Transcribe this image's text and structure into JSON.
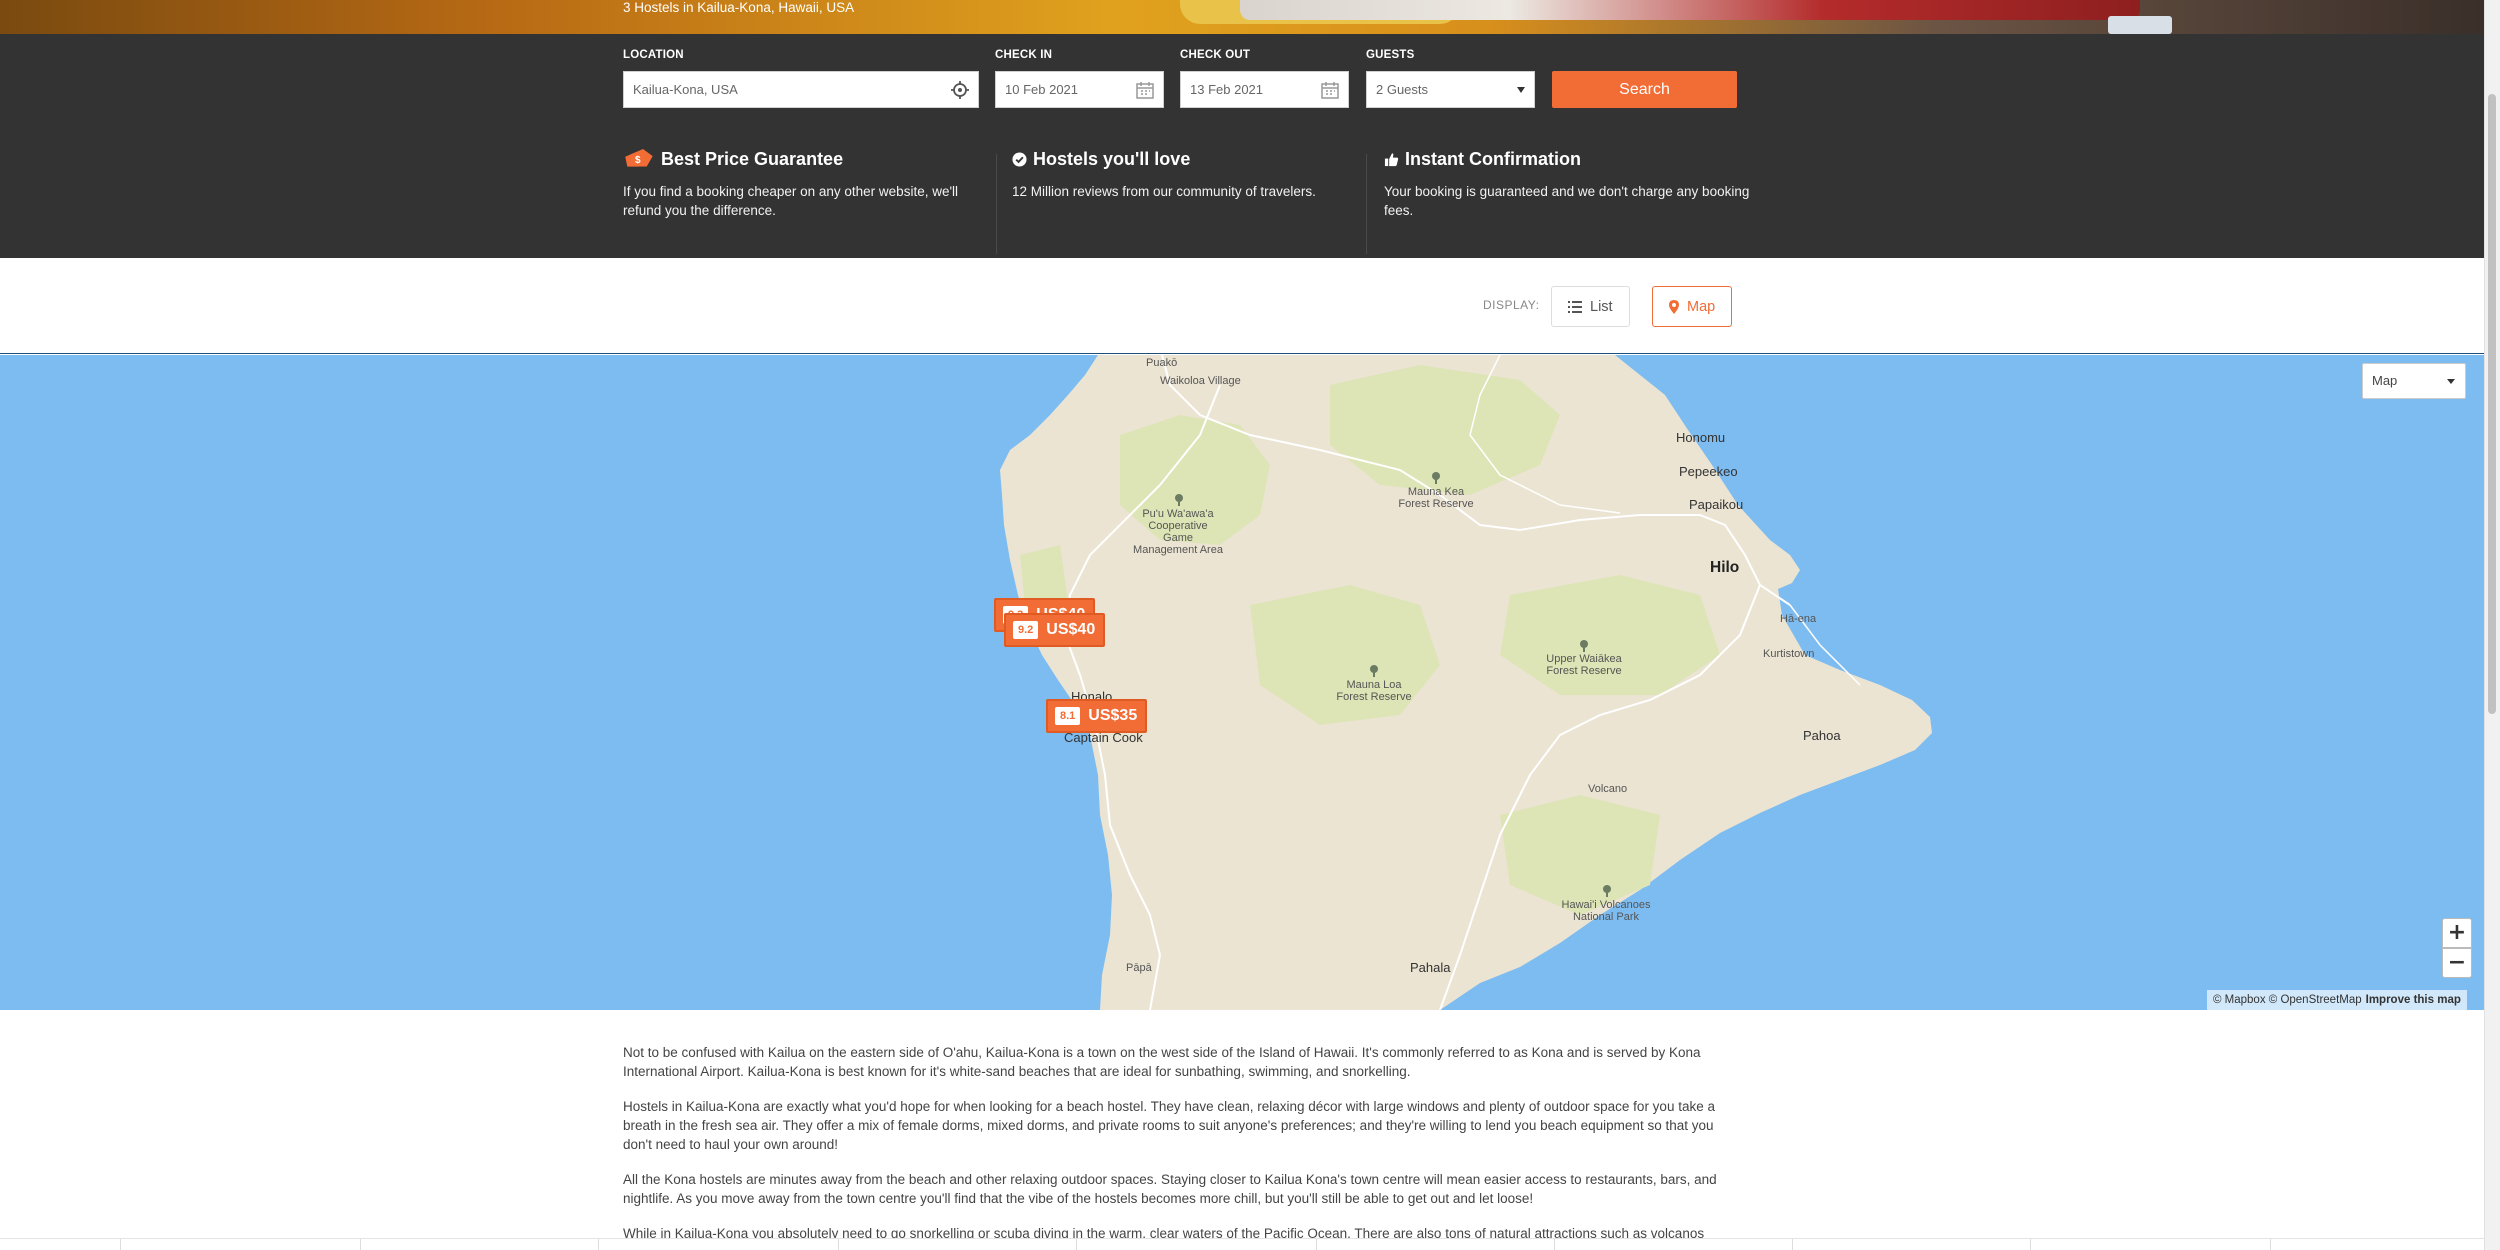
{
  "hero": {
    "title": "3 Hostels in Kailua-Kona, Hawaii, USA"
  },
  "search": {
    "location_label": "LOCATION",
    "location_value": "Kailua-Kona, USA",
    "checkin_label": "CHECK IN",
    "checkin_value": "10 Feb 2021",
    "checkout_label": "CHECK OUT",
    "checkout_value": "13 Feb 2021",
    "guests_label": "GUESTS",
    "guests_value": "2 Guests",
    "search_button": "Search"
  },
  "features": [
    {
      "title": "Best Price Guarantee",
      "text": "If you find a booking cheaper on any other website, we'll refund you the difference.",
      "icon": "price-tag-icon"
    },
    {
      "title": "Hostels you'll love",
      "text": "12 Million reviews from our community of travelers.",
      "icon": "check-circle-icon"
    },
    {
      "title": "Instant Confirmation",
      "text": "Your booking is guaranteed and we don't charge any booking fees.",
      "icon": "thumbs-up-icon"
    }
  ],
  "display": {
    "label": "DISPLAY:",
    "list_label": "List",
    "map_label": "Map",
    "active": "Map"
  },
  "map": {
    "style_select": "Map",
    "zoom_in": "+",
    "zoom_out": "−",
    "attribution": "© Mapbox © OpenStreetMap",
    "improve": "Improve this map",
    "labels": {
      "puako": "Puakō",
      "waikoloa": "Waikoloa Village",
      "puuwaawaa": "Pu'u Wa'awa'a Cooperative Game Management Area",
      "maunakea": "Mauna Kea Forest Reserve",
      "honomu": "Honomu",
      "pepeekeo": "Pepeekeo",
      "papaikou": "Papaikou",
      "hilo": "Hilo",
      "haena": "Hā-ena",
      "kurtistown": "Kurtistown",
      "upperwaiakea": "Upper Waiākea Forest Reserve",
      "maunaloa": "Mauna Loa Forest Reserve",
      "honalo": "Honalo",
      "captaincook": "Captain Cook",
      "pahoa": "Pahoa",
      "volcano": "Volcano",
      "hawaiivolcanoes": "Hawai'i Volcanoes National Park",
      "papa": "Pāpā",
      "pahala": "Pahala"
    },
    "markers": [
      {
        "score": "9.3",
        "price": "US$40"
      },
      {
        "score": "9.2",
        "price": "US$40"
      },
      {
        "score": "8.1",
        "price": "US$35"
      }
    ],
    "colors": {
      "water": "#7dbcf0",
      "land": "#ebe4d3",
      "park": "#dde5b6",
      "marker": "#f26c35"
    }
  },
  "description": {
    "p1": "Not to be confused with Kailua on the eastern side of O'ahu, Kailua-Kona is a town on the west side of the Island of Hawaii. It's commonly referred to as Kona and is served by Kona International Airport. Kailua-Kona is best known for it's white-sand beaches that are ideal for sunbathing, swimming, and snorkelling.",
    "p2": "Hostels in Kailua-Kona are exactly what you'd hope for when looking for a beach hostel. They have clean, relaxing décor with large windows and plenty of outdoor space for you take a breath in the fresh sea air. They offer a mix of female dorms, mixed dorms, and private rooms to suit anyone's preferences; and they're willing to lend you beach equipment so that you don't need to haul your own around!",
    "p3": "All the Kona hostels are minutes away from the beach and other relaxing outdoor spaces. Staying closer to Kailua Kona's town centre will mean easier access to restaurants, bars, and nightlife. As you move away from the town centre you'll find that the vibe of the hostels becomes more chill, but you'll still be able to get out and let loose!",
    "p4": "While in Kailua-Kona you absolutely need to go snorkelling or scuba diving in the warm, clear waters of the Pacific Ocean. There are also tons of natural attractions such as volcanos"
  },
  "theme": {
    "accent": "#f26c35",
    "band": "#333333",
    "link_blue": "#1d4f7a"
  }
}
